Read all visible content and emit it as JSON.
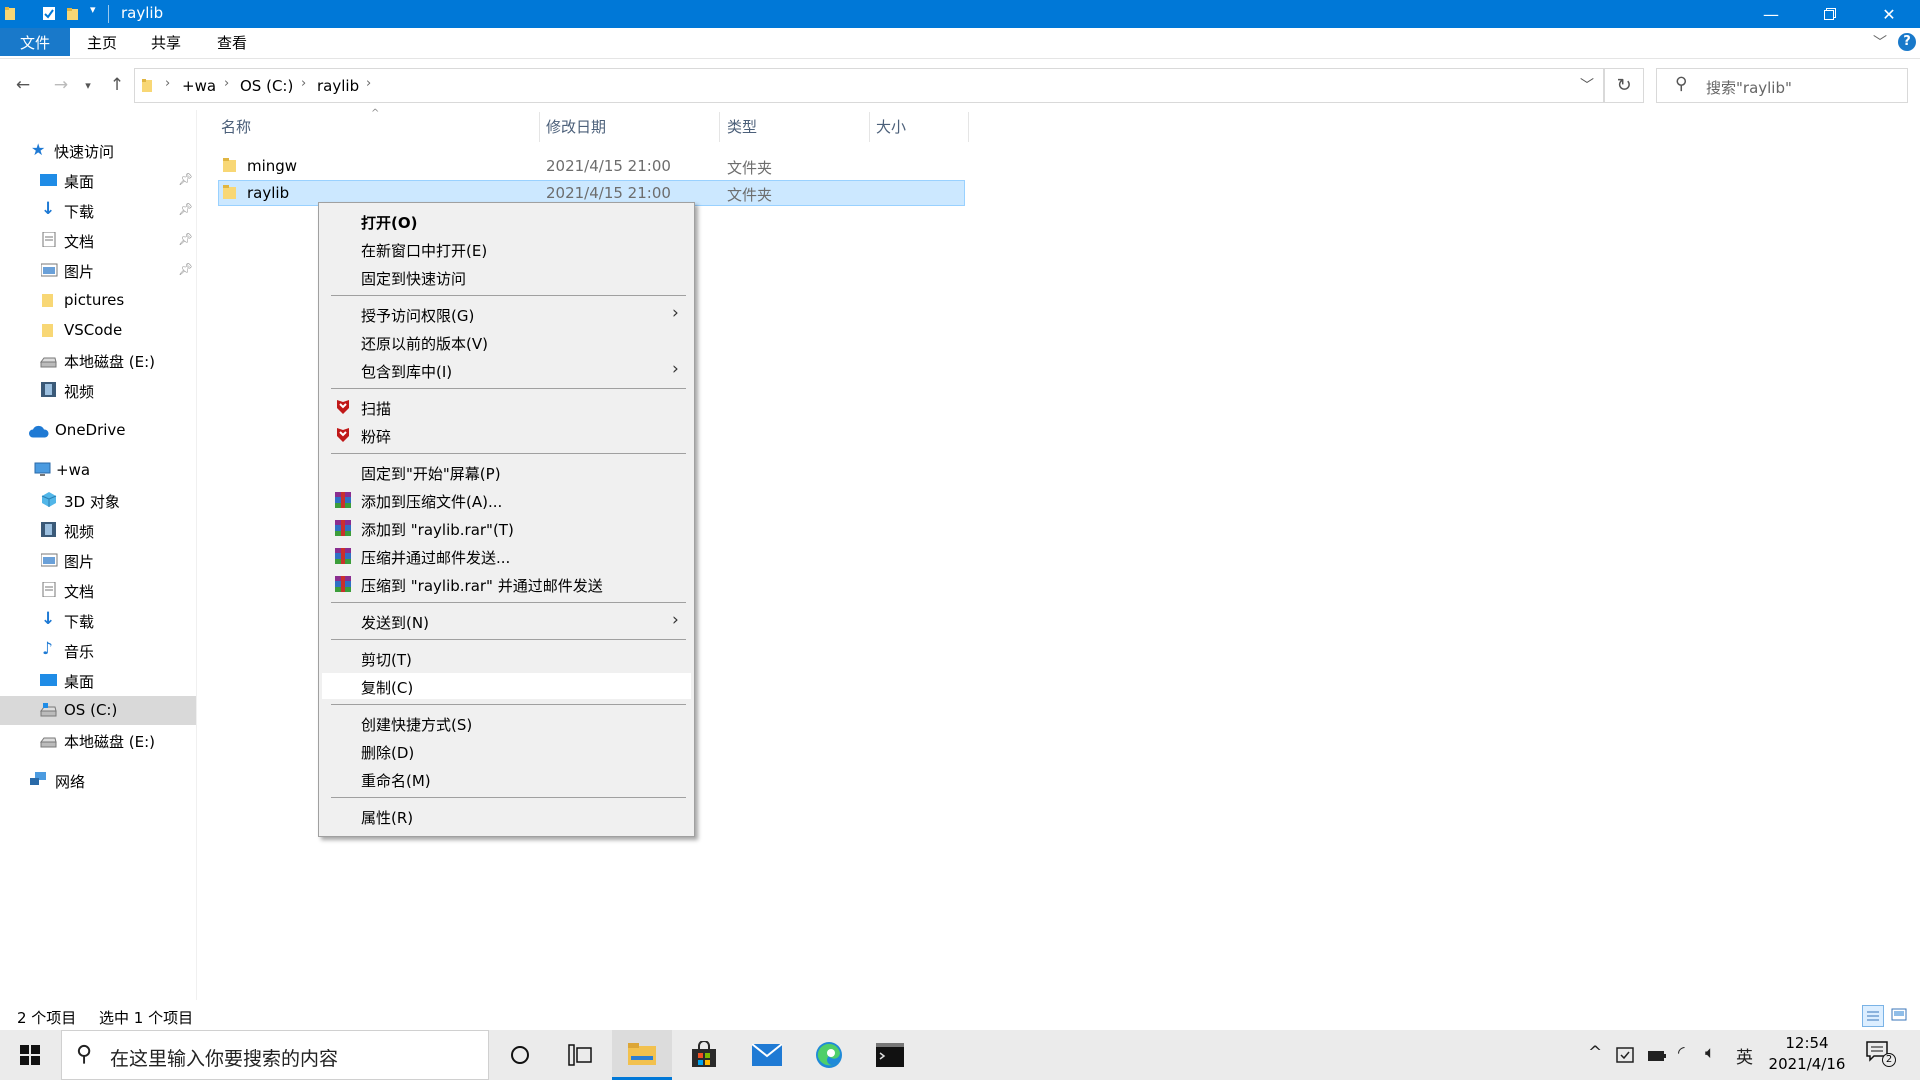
{
  "window": {
    "title": "raylib"
  },
  "ribbon": {
    "tabs": [
      "文件",
      "主页",
      "共享",
      "查看"
    ]
  },
  "address": {
    "crumbs": [
      "+wa",
      "OS (C:)",
      "raylib"
    ],
    "search_placeholder": "搜索\"raylib\""
  },
  "navpane": {
    "quick_access": "快速访问",
    "quick_items": [
      "桌面",
      "下载",
      "文档",
      "图片",
      "pictures",
      "VSCode",
      "本地磁盘 (E:)",
      "视频"
    ],
    "onedrive": "OneDrive",
    "this_pc": "+wa",
    "pc_items": [
      "3D 对象",
      "视频",
      "图片",
      "文档",
      "下载",
      "音乐",
      "桌面",
      "OS (C:)",
      "本地磁盘 (E:)"
    ],
    "network": "网络"
  },
  "list": {
    "headers": [
      "名称",
      "修改日期",
      "类型",
      "大小"
    ],
    "rows": [
      {
        "name": "mingw",
        "date": "2021/4/15 21:00",
        "type": "文件夹",
        "size": ""
      },
      {
        "name": "raylib",
        "date": "2021/4/15 21:00",
        "type": "文件夹",
        "size": ""
      }
    ]
  },
  "context_menu": {
    "items": [
      "打开(O)",
      "在新窗口中打开(E)",
      "固定到快速访问",
      "授予访问权限(G)",
      "还原以前的版本(V)",
      "包含到库中(I)",
      "扫描",
      "粉碎",
      "固定到\"开始\"屏幕(P)",
      "添加到压缩文件(A)...",
      "添加到 \"raylib.rar\"(T)",
      "压缩并通过邮件发送...",
      "压缩到 \"raylib.rar\" 并通过邮件发送",
      "发送到(N)",
      "剪切(T)",
      "复制(C)",
      "创建快捷方式(S)",
      "删除(D)",
      "重命名(M)",
      "属性(R)"
    ],
    "hovered": "复制(C)"
  },
  "status": {
    "count": "2 个项目",
    "selected": "选中 1 个项目"
  },
  "taskbar": {
    "search_placeholder": "在这里输入你要搜索的内容",
    "ime": "英",
    "time": "12:54",
    "date": "2021/4/16",
    "notifications": "2"
  },
  "colors": {
    "accent": "#0078d7",
    "selection": "#cce8ff",
    "menu_bg": "#f0f0f0"
  }
}
